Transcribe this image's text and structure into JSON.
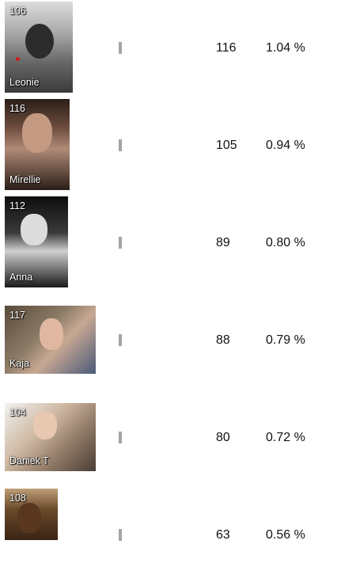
{
  "rows": [
    {
      "rank": "106",
      "name": "Leonie",
      "votes": "116",
      "percent": "1.04 %",
      "share": 0.0104,
      "colors": {
        "top": "#d9d9d9",
        "mid": "#8a8a8a",
        "bottom": "#3a3a3a"
      }
    },
    {
      "rank": "116",
      "name": "Mirellie",
      "votes": "105",
      "percent": "0.94 %",
      "share": 0.0094,
      "colors": {
        "top": "#3a2a22",
        "mid": "#a07a68",
        "bottom": "#1c1410"
      }
    },
    {
      "rank": "112",
      "name": "Anna",
      "votes": "89",
      "percent": "0.80 %",
      "share": 0.008,
      "colors": {
        "top": "#1a1a1a",
        "mid": "#d0d0d0",
        "bottom": "#2a2a2a"
      }
    },
    {
      "rank": "117",
      "name": "Kaja",
      "votes": "88",
      "percent": "0.79 %",
      "share": 0.0079,
      "colors": {
        "top": "#6a5a48",
        "mid": "#c8a090",
        "bottom": "#3a4a6a"
      }
    },
    {
      "rank": "104",
      "name": "Daniek T",
      "votes": "80",
      "percent": "0.72 %",
      "share": 0.0072,
      "colors": {
        "top": "#f0f0f0",
        "mid": "#b89a80",
        "bottom": "#5a4a40"
      }
    },
    {
      "rank": "108",
      "name": "",
      "votes": "63",
      "percent": "0.56 %",
      "share": 0.0056,
      "colors": {
        "top": "#b89a70",
        "mid": "#5a3a22",
        "bottom": "#2a1a10"
      }
    }
  ]
}
